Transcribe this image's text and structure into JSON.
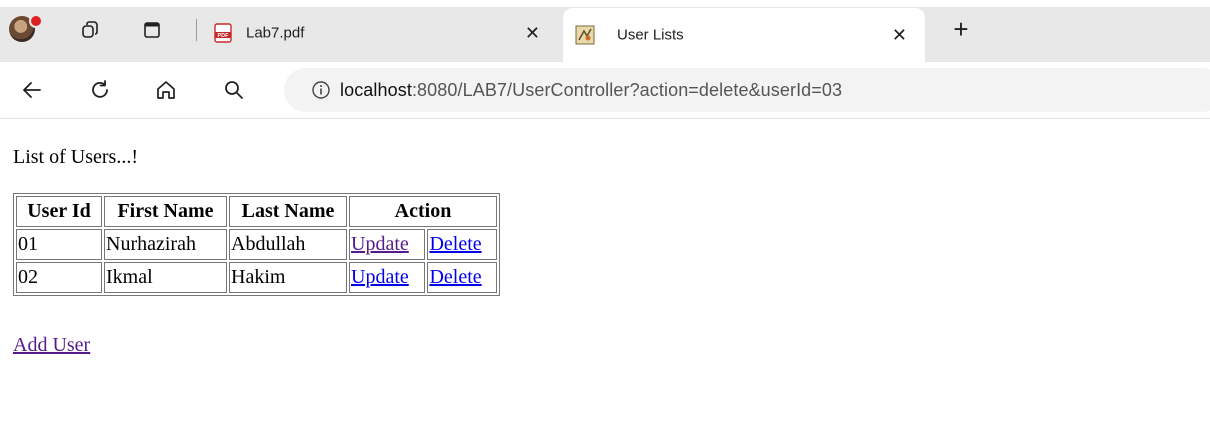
{
  "browser": {
    "tabs": [
      {
        "title": "Lab7.pdf",
        "favicon": "pdf-icon",
        "active": false
      },
      {
        "title": "User Lists",
        "favicon": "page-favicon-icon",
        "active": true
      }
    ],
    "address": {
      "host": "localhost",
      "path": ":8080/LAB7/UserController?action=delete&userId=03"
    }
  },
  "page": {
    "heading": "List of Users...!",
    "table": {
      "headers": [
        "User Id",
        "First Name",
        "Last Name",
        "Action"
      ],
      "rows": [
        {
          "id": "01",
          "first": "Nurhazirah",
          "last": "Abdullah",
          "update": "Update",
          "delete": "Delete"
        },
        {
          "id": "02",
          "first": "Ikmal",
          "last": "Hakim",
          "update": "Update",
          "delete": "Delete"
        }
      ]
    },
    "add_user": "Add User"
  },
  "colors": {
    "link": "#0000ee",
    "visited": "#551a8b",
    "tabstrip": "#e8e8e8"
  }
}
